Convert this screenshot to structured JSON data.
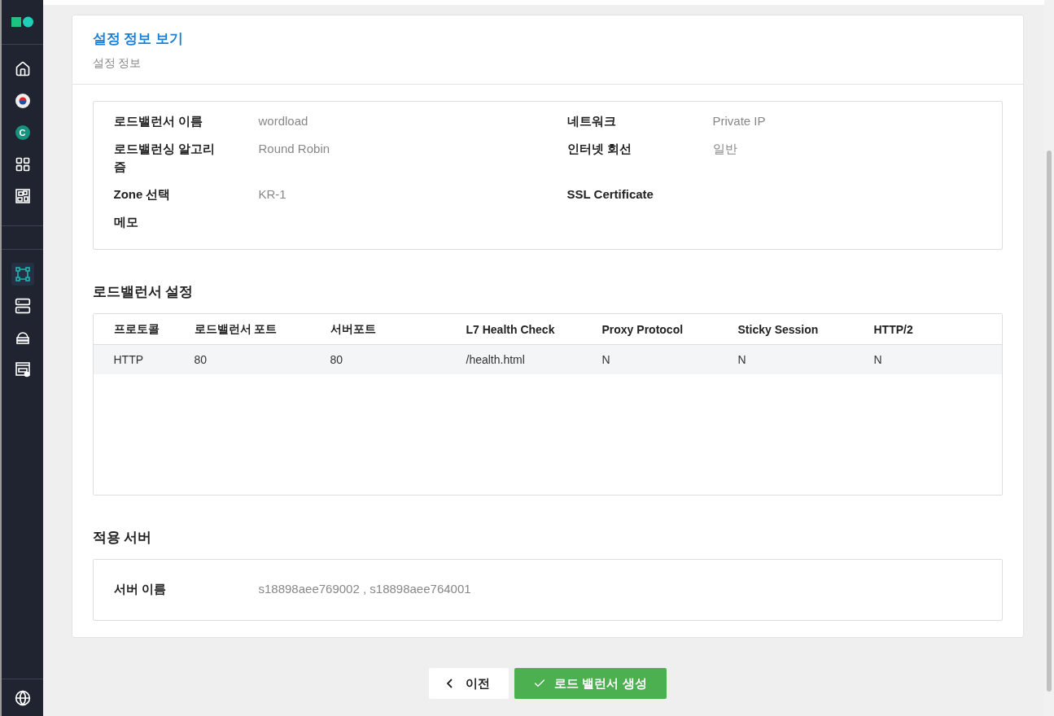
{
  "sidebar": {
    "top_items": [
      {
        "kind": "home",
        "selected": false
      },
      {
        "kind": "flag",
        "selected": false
      },
      {
        "kind": "letter",
        "label": "C",
        "selected": false
      },
      {
        "kind": "grid",
        "selected": false
      },
      {
        "kind": "board",
        "selected": false
      }
    ],
    "mid_items": [
      {
        "kind": "nodes",
        "selected": true
      },
      {
        "kind": "server",
        "selected": false
      },
      {
        "kind": "cloud",
        "selected": false
      },
      {
        "kind": "dns",
        "selected": false
      }
    ],
    "bottom_items": [
      {
        "kind": "globe",
        "selected": false
      }
    ]
  },
  "header": {
    "title": "설정 정보 보기",
    "subtitle": "설정 정보"
  },
  "info": [
    {
      "label": "로드밸런서 이름",
      "value": "wordload"
    },
    {
      "label": "네트워크",
      "value": "Private IP"
    },
    {
      "label": "로드밸런싱 알고리즘",
      "value": "Round Robin"
    },
    {
      "label": "인터넷 회선",
      "value": "일반"
    },
    {
      "label": "Zone 선택",
      "value": "KR-1"
    },
    {
      "label": "SSL Certificate"
    },
    {
      "label": "메모"
    }
  ],
  "lb_settings": {
    "title": "로드밸런서 설정",
    "columns": [
      "프로토콜",
      "로드밸런서 포트",
      "서버포트",
      "L7 Health Check",
      "Proxy Protocol",
      "Sticky Session",
      "HTTP/2"
    ],
    "rows": [
      [
        "HTTP",
        "80",
        "80",
        "/health.html",
        "N",
        "N",
        "N"
      ]
    ]
  },
  "servers": {
    "title": "적용 서버",
    "label": "서버 이름",
    "value": "s18898aee769002 , s18898aee764001"
  },
  "buttons": {
    "back": "이전",
    "create": "로드 밸런서 생성"
  }
}
